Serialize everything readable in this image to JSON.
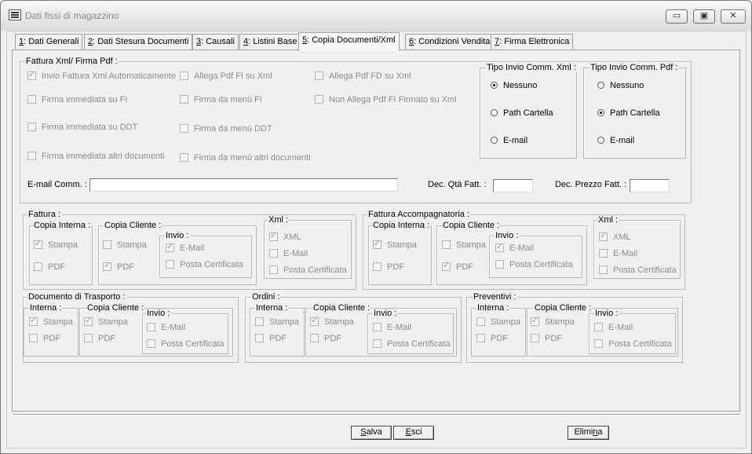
{
  "window": {
    "title": "Dati fissi di magazzino",
    "controls": {
      "minimize": "▭",
      "maximize": "▣",
      "close": "✕"
    }
  },
  "tabs": [
    {
      "key": "1",
      "rest": ": Dati Generali"
    },
    {
      "key": "2",
      "rest": ": Dati Stesura Documenti"
    },
    {
      "key": "3",
      "rest": ": Causali"
    },
    {
      "key": "4",
      "rest": ": Listini Base"
    },
    {
      "key": "5",
      "rest": ": Copia Documenti/Xml"
    },
    {
      "key": "6",
      "rest": ": Condizioni Vendita"
    },
    {
      "key": "7",
      "rest": ": Firma Elettronica"
    }
  ],
  "fattura_xml": {
    "legend": "Fattura Xml/ Firma Pdf :",
    "col1": [
      "Invio Fattura Xml Automaticamente",
      "Firma immediata su FI",
      "Firma immediata su DDT",
      "Firma immediata altri documenti"
    ],
    "col2": [
      "Allega Pdf FI su Xml",
      "Firma da menù FI",
      "Firma da menù DDT",
      "Firma da menù altri documenti"
    ],
    "col3": [
      "Allega Pdf FD su Xml",
      "Non Allega Pdf FI Firmato su Xml"
    ],
    "email_label": "E-mail Comm. :",
    "email_value": "",
    "dec_qta_label": "Dec. Qtà Fatt. :",
    "dec_qta_value": "",
    "dec_prezzo_label": "Dec. Prezzo Fatt. :",
    "dec_prezzo_value": ""
  },
  "tipo_xml": {
    "legend": "Tipo Invio Comm. Xml :",
    "options": [
      "Nessuno",
      "Path Cartella",
      "E-mail"
    ],
    "selected": "Nessuno"
  },
  "tipo_pdf": {
    "legend": "Tipo Invio Comm. Pdf :",
    "options": [
      "Nessuno",
      "Path Cartella",
      "E-mail"
    ],
    "selected": "Path Cartella"
  },
  "labels": {
    "fattura": "Fattura :",
    "fattura_acc": "Fattura Accompagnatoria :",
    "ddt": "Documento di Trasporto :",
    "ordini": "Ordini :",
    "preventivi": "Preventivi :",
    "copia_interna": "Copia Interna :",
    "copia_cliente": "Copia Cliente :",
    "interna": "Interna :",
    "invio": "Invio :",
    "xml": "Xml :",
    "stampa": "Stampa",
    "pdf": "PDF",
    "xml_opt": "XML",
    "email": "E-Mail",
    "posta": "Posta Certificata"
  },
  "buttons": {
    "salva_key": "S",
    "salva_rest": "alva",
    "esci_key": "E",
    "esci_rest": "sci",
    "elimina_pre": "Elimi",
    "elimina_key": "n",
    "elimina_post": "a"
  }
}
